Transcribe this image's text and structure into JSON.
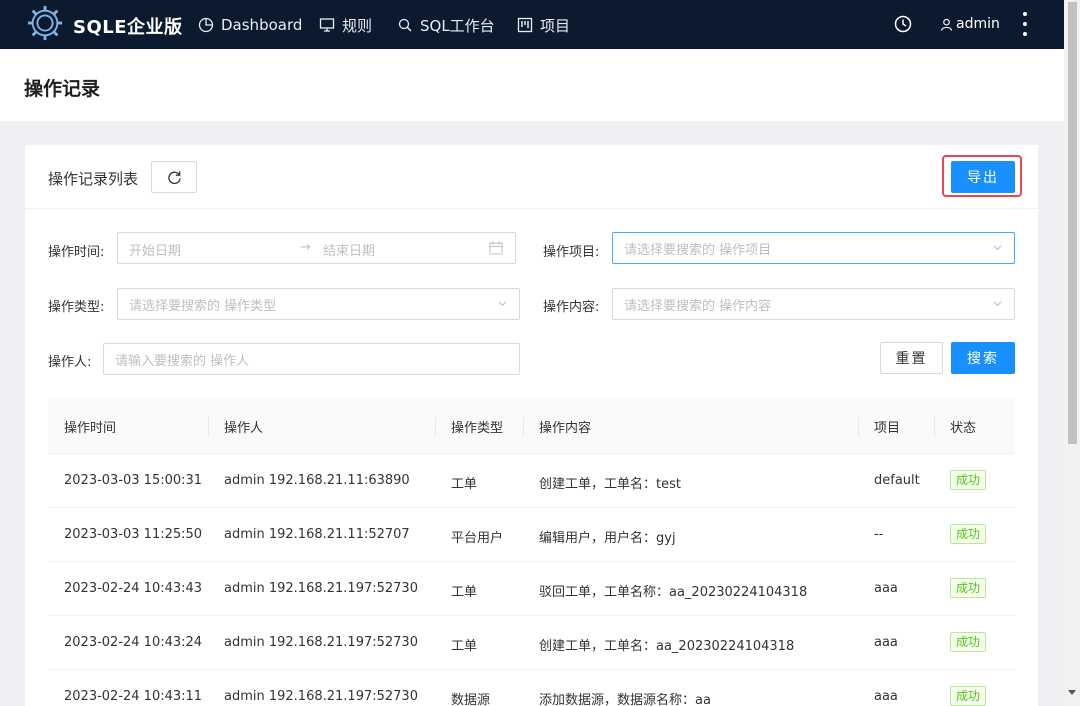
{
  "nav": {
    "brand": "SQLE企业版",
    "items": [
      {
        "label": "Dashboard",
        "icon": "pie-chart-icon"
      },
      {
        "label": "规则",
        "icon": "desktop-icon"
      },
      {
        "label": "SQL工作台",
        "icon": "search-icon"
      },
      {
        "label": "项目",
        "icon": "project-icon"
      }
    ],
    "user": "admin"
  },
  "page": {
    "title": "操作记录"
  },
  "card": {
    "title": "操作记录列表",
    "export_label": "导出"
  },
  "filters": {
    "time_label": "操作时间:",
    "start_placeholder": "开始日期",
    "range_arrow": "→",
    "end_placeholder": "结束日期",
    "project_label": "操作项目:",
    "project_placeholder": "请选择要搜索的 操作项目",
    "type_label": "操作类型:",
    "type_placeholder": "请选择要搜索的 操作类型",
    "content_label": "操作内容:",
    "content_placeholder": "请选择要搜索的 操作内容",
    "user_label": "操作人:",
    "user_placeholder": "请输入要搜索的 操作人",
    "reset_label": "重置",
    "search_label": "搜索"
  },
  "table": {
    "columns": [
      "操作时间",
      "操作人",
      "操作类型",
      "操作内容",
      "项目",
      "状态"
    ],
    "rows": [
      {
        "time": "2023-03-03 15:00:31",
        "user": "admin 192.168.21.11:63890",
        "type": "工单",
        "content": "创建工单，工单名：test",
        "project": "default",
        "status": "成功"
      },
      {
        "time": "2023-03-03 11:25:50",
        "user": "admin 192.168.21.11:52707",
        "type": "平台用户",
        "content": "编辑用户，用户名：gyj",
        "project": "--",
        "status": "成功"
      },
      {
        "time": "2023-02-24 10:43:43",
        "user": "admin 192.168.21.197:52730",
        "type": "工单",
        "content": "驳回工单，工单名称：aa_20230224104318",
        "project": "aaa",
        "status": "成功"
      },
      {
        "time": "2023-02-24 10:43:24",
        "user": "admin 192.168.21.197:52730",
        "type": "工单",
        "content": "创建工单，工单名：aa_20230224104318",
        "project": "aaa",
        "status": "成功"
      },
      {
        "time": "2023-02-24 10:43:11",
        "user": "admin 192.168.21.197:52730",
        "type": "数据源",
        "content": "添加数据源，数据源名称：aa",
        "project": "aaa",
        "status": "成功"
      }
    ]
  },
  "colors": {
    "nav_bg": "#0b1a2f",
    "primary": "#1890ff",
    "highlight_border": "#e8474b",
    "success": "#52c41a"
  }
}
